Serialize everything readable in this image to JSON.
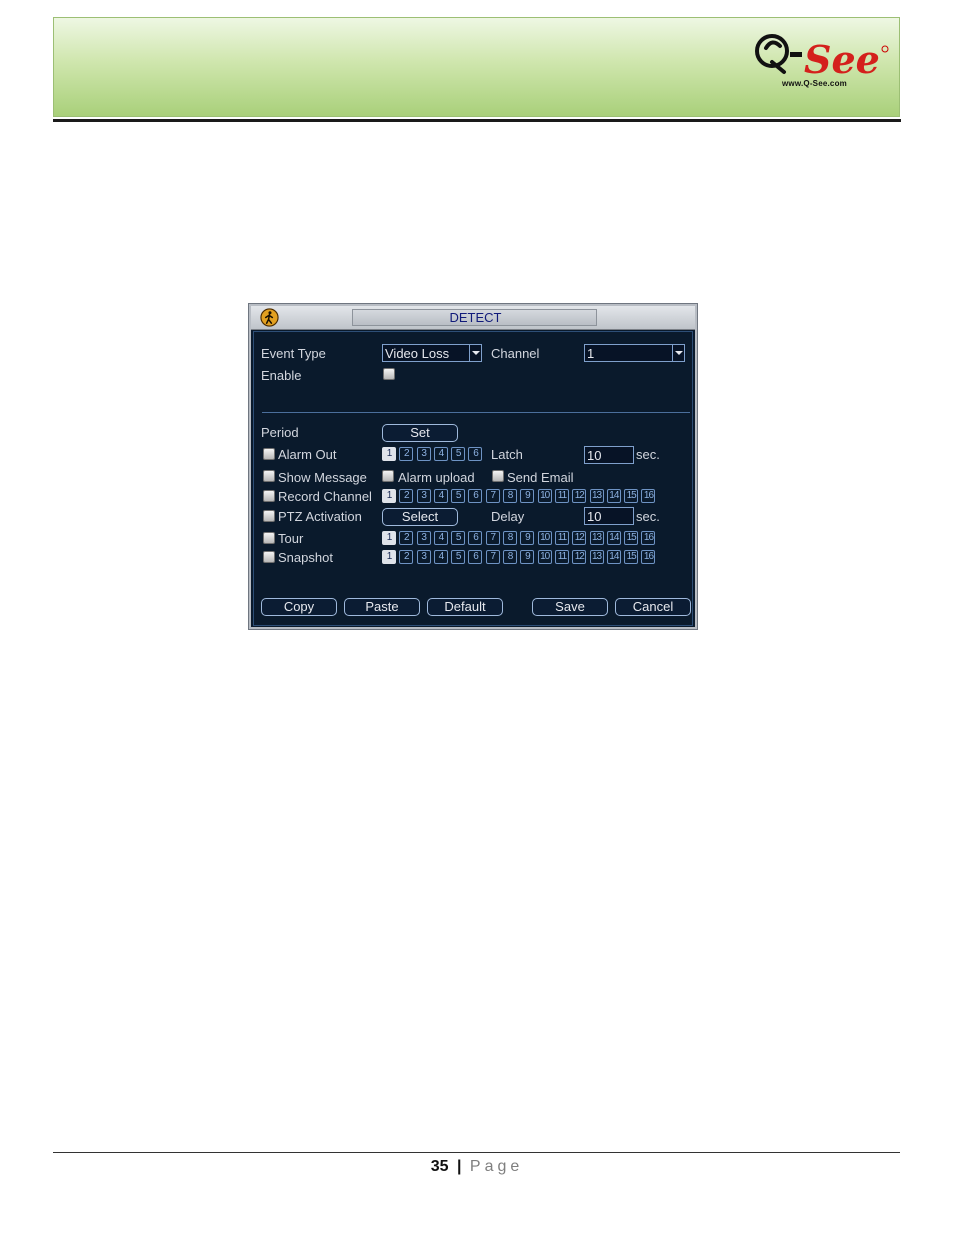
{
  "header": {
    "logo_text": "Q-See",
    "logo_url": "www.Q-See.com"
  },
  "dialog": {
    "title": "DETECT",
    "event_type_label": "Event Type",
    "event_type_value": "Video Loss",
    "channel_label": "Channel",
    "channel_value": "1",
    "enable_label": "Enable",
    "period_label": "Period",
    "set_button": "Set",
    "alarm_out_label": "Alarm Out",
    "alarm_out_boxes": [
      "1",
      "2",
      "3",
      "4",
      "5",
      "6"
    ],
    "latch_label": "Latch",
    "latch_value": "10",
    "latch_unit": "sec.",
    "show_message_label": "Show Message",
    "alarm_upload_label": "Alarm upload",
    "send_email_label": "Send Email",
    "record_channel_label": "Record Channel",
    "channel_boxes": [
      "1",
      "2",
      "3",
      "4",
      "5",
      "6",
      "7",
      "8",
      "9",
      "10",
      "11",
      "12",
      "13",
      "14",
      "15",
      "16"
    ],
    "ptz_label": "PTZ Activation",
    "select_button": "Select",
    "delay_label": "Delay",
    "delay_value": "10",
    "delay_unit": "sec.",
    "tour_label": "Tour",
    "snapshot_label": "Snapshot",
    "buttons": {
      "copy": "Copy",
      "paste": "Paste",
      "default": "Default",
      "save": "Save",
      "cancel": "Cancel"
    }
  },
  "footer": {
    "page_number": "35",
    "separator": "|",
    "page_word": "Page"
  }
}
